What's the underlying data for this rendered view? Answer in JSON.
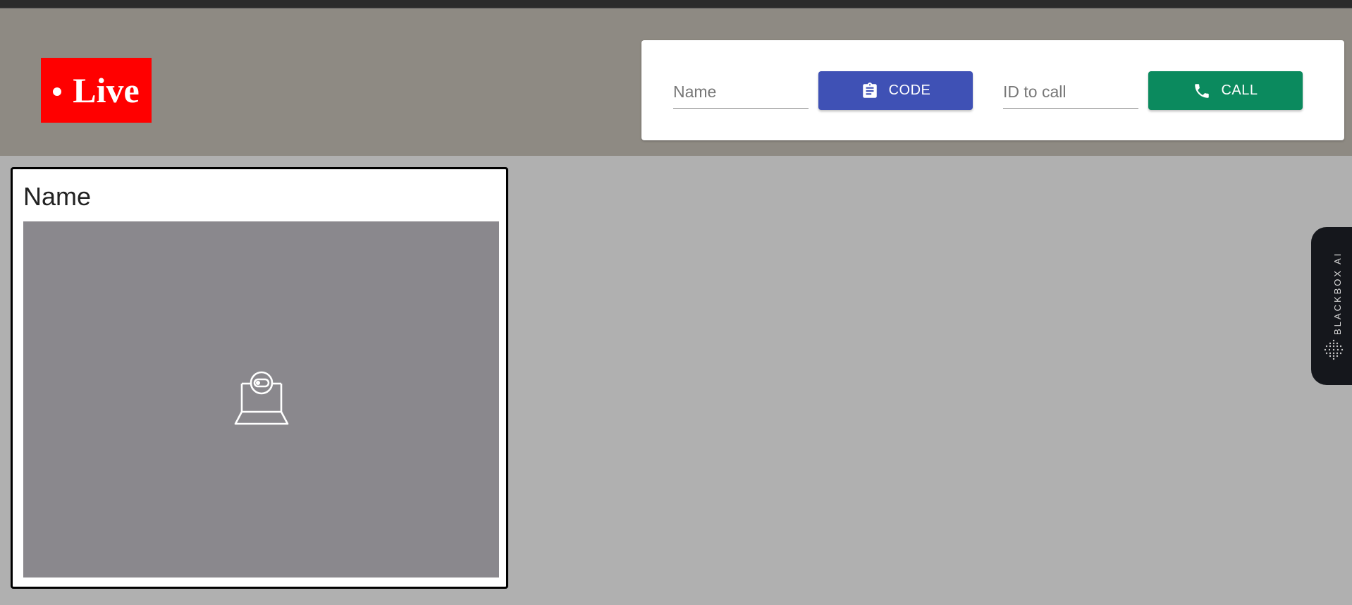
{
  "header": {
    "live_label": "Live"
  },
  "call_panel": {
    "name_input": {
      "placeholder": "Name",
      "value": ""
    },
    "code_button_label": "CODE",
    "id_input": {
      "placeholder": "ID to call",
      "value": ""
    },
    "call_button_label": "CALL"
  },
  "user_card": {
    "title": "Name",
    "video_icon": "webcam-placeholder-icon"
  },
  "side_tab": {
    "label": "BLACKBOX AI"
  },
  "colors": {
    "live_red": "#ff0000",
    "code_blue": "#3f51b5",
    "call_green": "#0b8a5e",
    "header_bg": "#8e8a83",
    "page_bg": "#b0b0b0"
  }
}
